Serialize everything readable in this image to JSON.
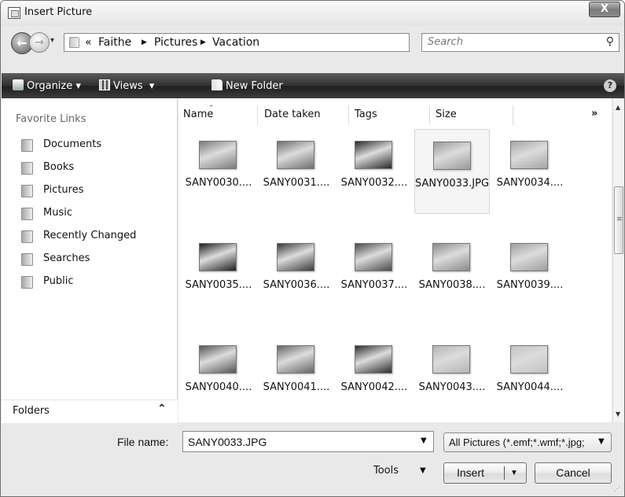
{
  "window": {
    "title": "Insert Picture",
    "close_label": "X"
  },
  "address": {
    "overflow_marker": "«",
    "separator": "▶",
    "breadcrumb": [
      "Faithe",
      "Pictures",
      "Vacation"
    ],
    "search_placeholder": "Search"
  },
  "toolbar": {
    "organize_label": "Organize",
    "views_label": "Views",
    "new_folder_label": "New Folder",
    "help_label": "?"
  },
  "left_pane": {
    "title": "Favorite Links",
    "items": [
      {
        "label": "Documents",
        "icon": "documents-icon"
      },
      {
        "label": "Books",
        "icon": "folder-icon"
      },
      {
        "label": "Pictures",
        "icon": "pictures-icon"
      },
      {
        "label": "Music",
        "icon": "music-icon"
      },
      {
        "label": "Recently Changed",
        "icon": "recent-icon"
      },
      {
        "label": "Searches",
        "icon": "searches-icon"
      },
      {
        "label": "Public",
        "icon": "folder-icon"
      }
    ],
    "folders_label": "Folders"
  },
  "columns": [
    "Name",
    "Date taken",
    "Tags",
    "Size"
  ],
  "columns_more": "»",
  "files": [
    {
      "name": "SANY0030....",
      "tone": "#7d7d7d"
    },
    {
      "name": "SANY0031....",
      "tone": "#6f6f6f"
    },
    {
      "name": "SANY0032....",
      "tone": "#2a2a2a"
    },
    {
      "name": "SANY0033.JPG",
      "tone": "#9a9a9a",
      "selected": true
    },
    {
      "name": "SANY0034....",
      "tone": "#a6a6a6"
    },
    {
      "name": "SANY0035....",
      "tone": "#1f1f1f"
    },
    {
      "name": "SANY0036....",
      "tone": "#3a3a3a"
    },
    {
      "name": "SANY0037....",
      "tone": "#4a4a4a"
    },
    {
      "name": "SANY0038....",
      "tone": "#8a8a8a"
    },
    {
      "name": "SANY0039....",
      "tone": "#9e9e9e"
    },
    {
      "name": "SANY0040....",
      "tone": "#555555"
    },
    {
      "name": "SANY0041....",
      "tone": "#666666"
    },
    {
      "name": "SANY0042....",
      "tone": "#2e2e2e"
    },
    {
      "name": "SANY0043....",
      "tone": "#b5b5b5"
    },
    {
      "name": "SANY0044....",
      "tone": "#c2c2c2"
    }
  ],
  "bottom": {
    "file_name_label": "File name:",
    "file_name_value": "SANY0033.JPG",
    "filter_value": "All Pictures (*.emf;*.wmf;*.jpg;",
    "tools_label": "Tools",
    "insert_label": "Insert",
    "cancel_label": "Cancel"
  }
}
